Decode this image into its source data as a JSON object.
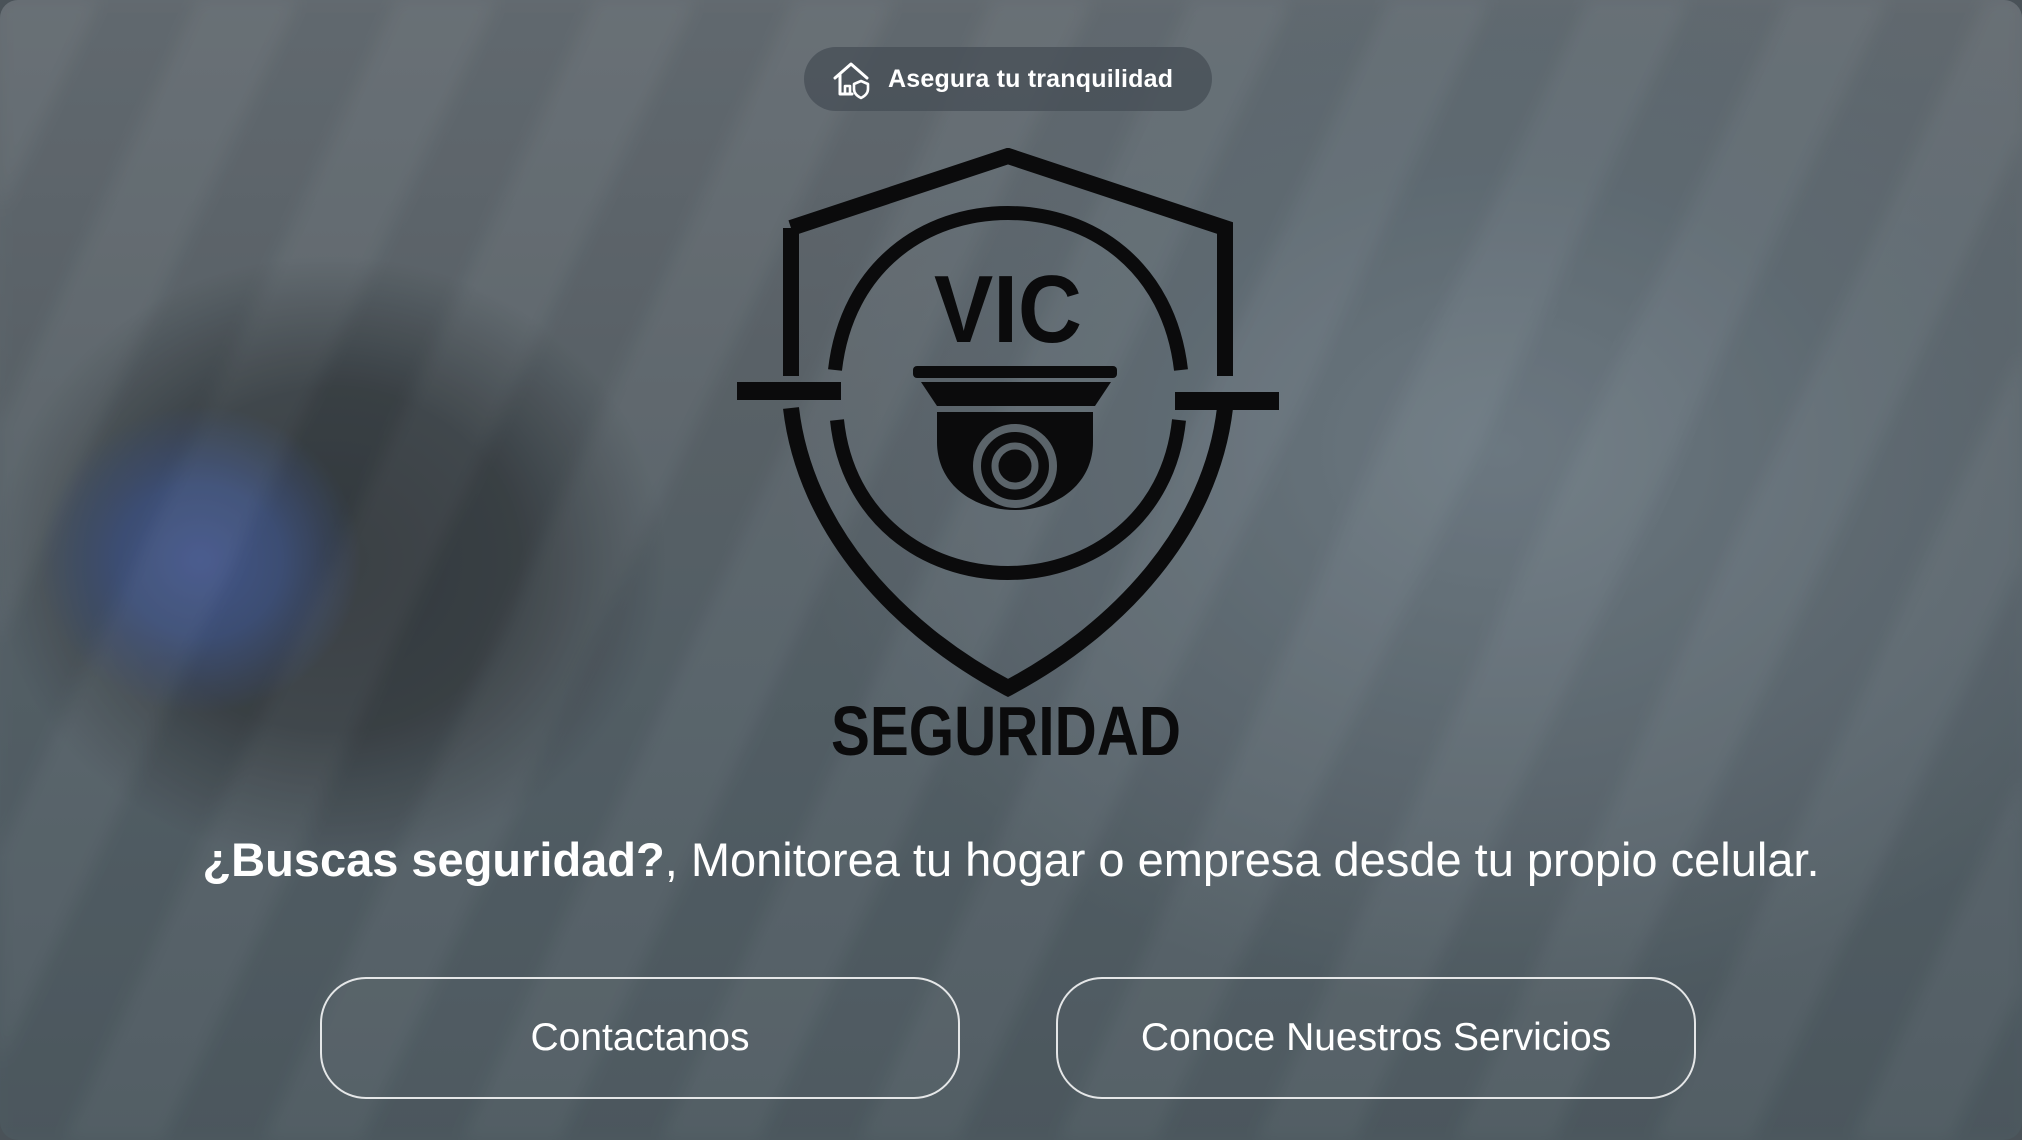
{
  "badge": {
    "text": "Asegura tu tranquilidad",
    "icon": "home-shield-icon"
  },
  "logo": {
    "title": "VIC",
    "subtitle": "SEGURIDAD",
    "icon": "dome-camera-shield-icon"
  },
  "headline": {
    "strong": "¿Buscas seguridad?",
    "rest": ", Monitorea tu hogar o empresa desde tu propio celular."
  },
  "buttons": {
    "contact_label": "Contactanos",
    "services_label": "Conoce Nuestros Servicios"
  },
  "colors": {
    "text": "#ffffff",
    "logo": "#0b0b0c",
    "button_border": "#ffffff"
  }
}
